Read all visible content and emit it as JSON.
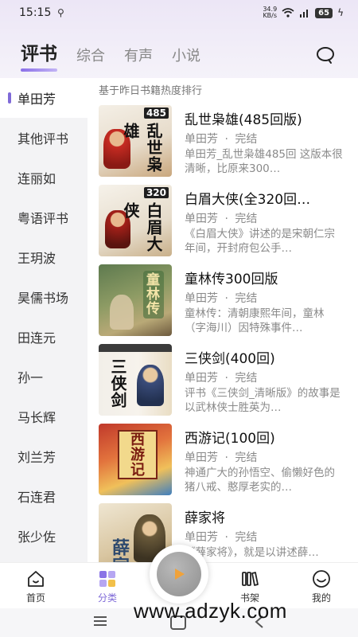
{
  "status_bar": {
    "time": "15:15",
    "usb_icon": "usb-icon",
    "speed_value": "34.9",
    "speed_unit": "KB/s",
    "battery": "65",
    "icons": [
      "wifi-icon",
      "signal-icon",
      "battery-icon",
      "charging-icon"
    ]
  },
  "header": {
    "tabs": [
      {
        "label": "评书",
        "active": true
      },
      {
        "label": "综合",
        "active": false
      },
      {
        "label": "有声",
        "active": false
      },
      {
        "label": "小说",
        "active": false
      }
    ],
    "search_icon": "search-icon"
  },
  "sidebar": {
    "items": [
      {
        "label": "单田芳",
        "active": true
      },
      {
        "label": "其他评书"
      },
      {
        "label": "连丽如"
      },
      {
        "label": "粤语评书"
      },
      {
        "label": "王玥波"
      },
      {
        "label": "昊儒书场"
      },
      {
        "label": "田连元"
      },
      {
        "label": "孙一"
      },
      {
        "label": "马长辉"
      },
      {
        "label": "刘兰芳"
      },
      {
        "label": "石连君"
      },
      {
        "label": "张少佐"
      }
    ]
  },
  "main": {
    "caption": "基于昨日书籍热度排行",
    "books": [
      {
        "title": "乱世枭雄(485回版)",
        "author": "单田芳",
        "sep": "·",
        "status": "完结",
        "desc": "单田芳_乱世枭雄485回 这版本很清晰，比原来300…",
        "cover_title": "乱世枭雄",
        "cover_tag": "485"
      },
      {
        "title": "白眉大侠(全320回…",
        "author": "单田芳",
        "sep": "·",
        "status": "完结",
        "desc": "《白眉大侠》讲述的是宋朝仁宗年间，开封府包公手…",
        "cover_title": "白眉大侠",
        "cover_tag": "320"
      },
      {
        "title": "童林传300回版",
        "author": "单田芳",
        "sep": "·",
        "status": "完结",
        "desc": "童林传：清朝康熙年间，童林（字海川）因特殊事件…",
        "cover_title": "童林传",
        "cover_tag": ""
      },
      {
        "title": "三侠剑(400回)",
        "author": "单田芳",
        "sep": "·",
        "status": "完结",
        "desc": "评书《三侠剑_清晰版》的故事是以武林侠士胜英为…",
        "cover_title": "三侠剑",
        "cover_tag": ""
      },
      {
        "title": "西游记(100回)",
        "author": "单田芳",
        "sep": "·",
        "status": "完结",
        "desc": "神通广大的孙悟空、偷懒好色的猪八戒、憨厚老实的…",
        "cover_title": "西游记",
        "cover_tag": ""
      },
      {
        "title": "薛家将",
        "author": "单田芳",
        "sep": "·",
        "status": "完结",
        "desc": "《薛家将》，就是以讲述薛…",
        "cover_title": "薛家",
        "cover_tag": ""
      }
    ]
  },
  "bottom_nav": {
    "items": [
      {
        "label": "首页",
        "icon": "home-icon"
      },
      {
        "label": "分类",
        "icon": "category-icon",
        "active": true
      },
      {
        "label": "书架",
        "icon": "bookshelf-icon"
      },
      {
        "label": "我的",
        "icon": "profile-icon"
      }
    ],
    "play_icon": "play-icon"
  },
  "watermark": "www.adzyk.com",
  "colors": {
    "accent": "#7f6ad8",
    "text": "#222222",
    "muted": "#8a8a8a"
  }
}
